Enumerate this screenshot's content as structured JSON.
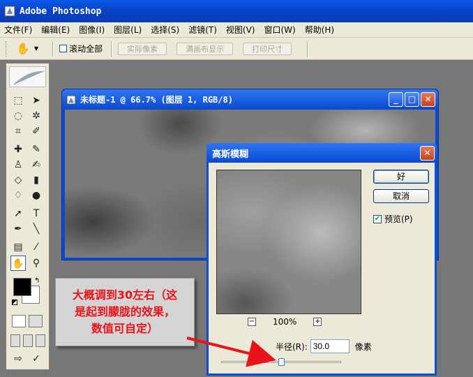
{
  "app": {
    "title": "Adobe Photoshop"
  },
  "menu": [
    "文件(F)",
    "编辑(E)",
    "图像(I)",
    "图层(L)",
    "选择(S)",
    "滤镜(T)",
    "视图(V)",
    "窗口(W)",
    "帮助(H)"
  ],
  "options": {
    "scroll_all_label": "滚动全部",
    "scroll_all_checked": false,
    "actual_pixels": "实际像素",
    "fit_screen": "满画布显示",
    "print_size": "打印尺寸"
  },
  "document": {
    "title": "未标题-1 @ 66.7% (图层 1, RGB/8)"
  },
  "dialog": {
    "title": "高斯模糊",
    "ok": "好",
    "cancel": "取消",
    "preview_label": "预览(P)",
    "preview_checked": true,
    "zoom": "100%",
    "radius_label": "半径(R):",
    "radius_value": "30.0",
    "unit": "像素",
    "slider_fraction": 0.5
  },
  "annotation": {
    "lines": [
      "大概调到30左右（这",
      "是起到朦胧的效果，",
      "数值可自定）"
    ]
  },
  "colors": {
    "titlebar": "#0a4fd6",
    "annotation_text": "#e8141b",
    "arrow": "#e8141b"
  }
}
